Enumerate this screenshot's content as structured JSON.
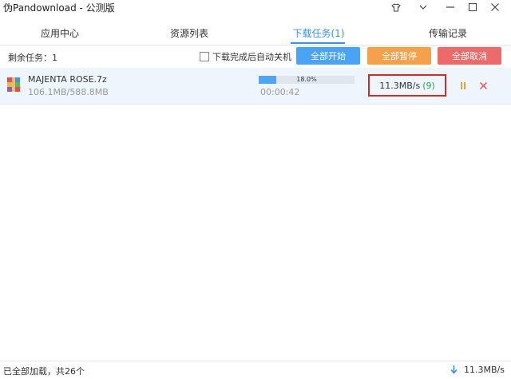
{
  "window": {
    "title": "伪Pandownload - 公测版"
  },
  "tabs": [
    {
      "label": "应用中心"
    },
    {
      "label": "资源列表"
    },
    {
      "label": "下载任务(1)"
    },
    {
      "label": "传输记录"
    }
  ],
  "toolbar": {
    "remaining": "剩余任务：1",
    "auto_shutdown_label": "下载完成后自动关机",
    "auto_shutdown_checked": false,
    "start_all": "全部开始",
    "pause_all": "全部暂停",
    "cancel_all": "全部取消"
  },
  "download": {
    "filename": "MAJENTA ROSE.7z",
    "size": "106.1MB/588.8MB",
    "progress_text": "18.0%",
    "progress": 0.18,
    "elapsed": "00:00:42",
    "speed": "11.3MB/s",
    "connections": "(9)"
  },
  "status": {
    "left": "已全部加载，共26个",
    "speed": "11.3MB/s"
  },
  "colors": {
    "accent": "#3d8fe0",
    "start_button": "#4aa3f5",
    "pause_button": "#f5a04a",
    "cancel_button": "#ec6a6a",
    "highlight_border": "#c9302c",
    "connections_text": "#2ea44f"
  },
  "icons": [
    "shirt-icon",
    "minimize-icon",
    "maximize-icon",
    "close-icon",
    "archive-file-icon",
    "pause-icon",
    "cancel-icon",
    "download-arrow-icon"
  ]
}
